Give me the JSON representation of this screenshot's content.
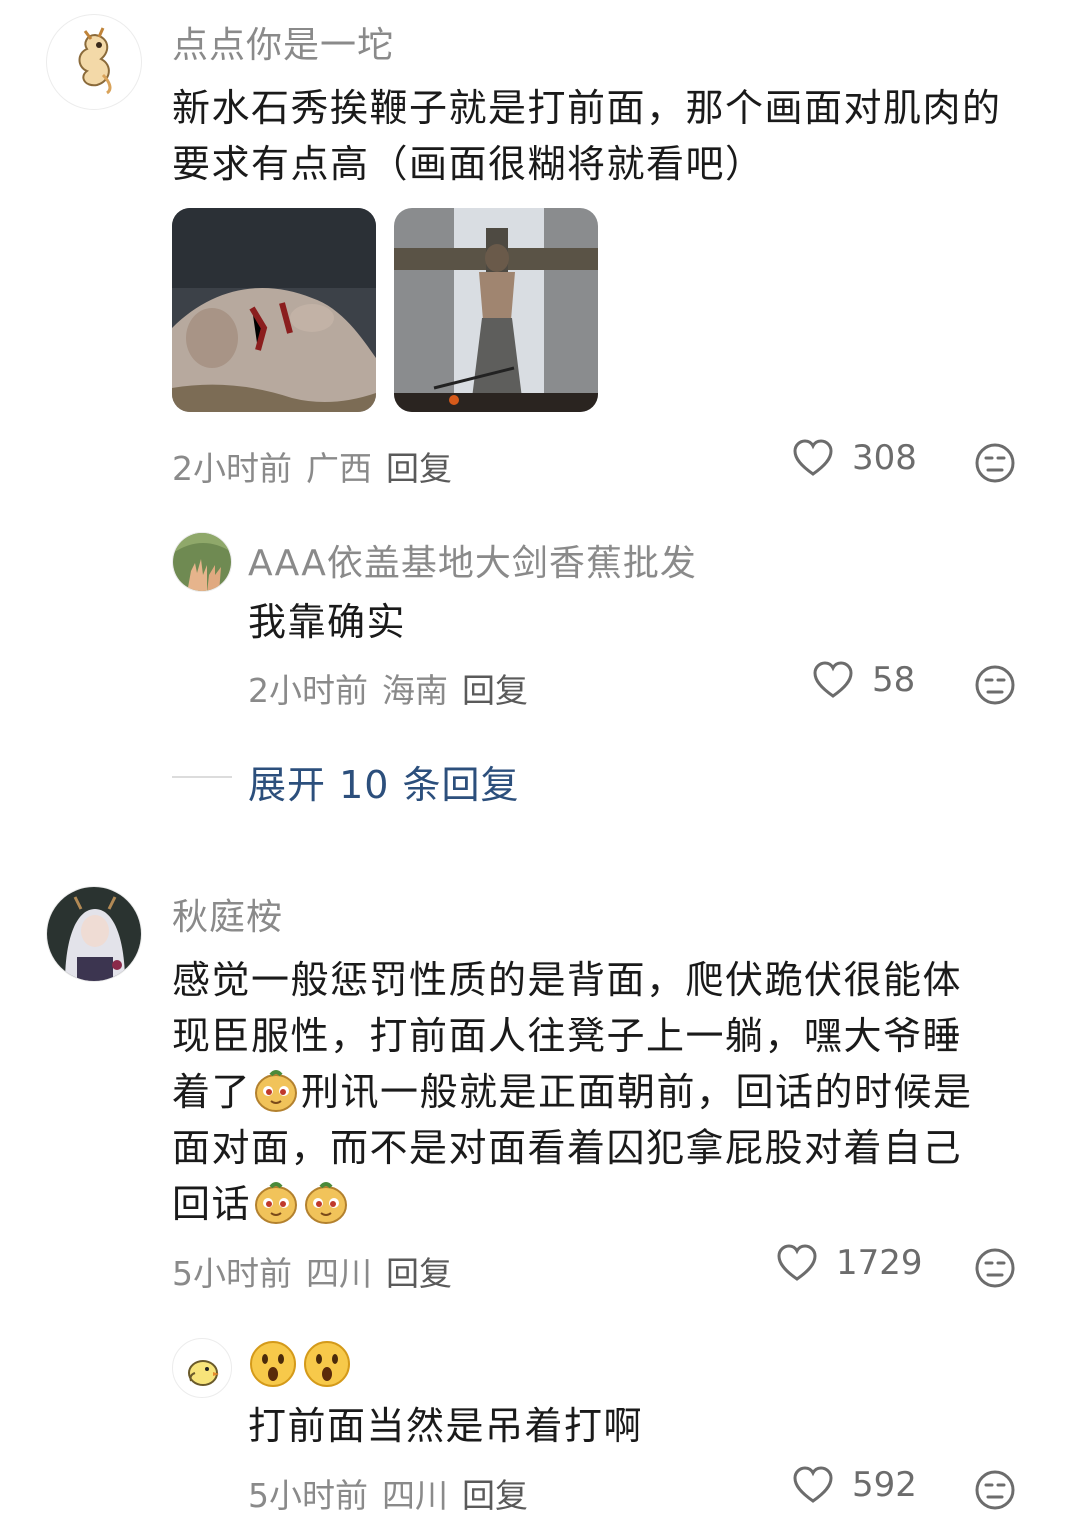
{
  "comments": [
    {
      "username": "点点你是一坨",
      "text": "新水石秀挨鞭子就是打前面，那个画面对肌肉的要求有点高（画面很糊将就看吧）",
      "time": "2小时前",
      "location": "广西",
      "reply_label": "回复",
      "likes": "308",
      "avatar_icon": "dragon-sticker-avatar",
      "images": [
        "bloody-man-lying-photo",
        "man-bound-on-cross-photo"
      ],
      "replies": [
        {
          "username": "AAA依盖基地大剑香蕉批发",
          "text": "我靠确实",
          "time": "2小时前",
          "location": "海南",
          "reply_label": "回复",
          "likes": "58",
          "avatar_icon": "hands-in-grass-avatar"
        }
      ],
      "expand_label": "展开 10 条回复"
    },
    {
      "username": "秋庭桉",
      "text_line1": "感觉一般惩罚性质的是背面，爬伏跪伏很能体",
      "text_line2": "现臣服性，打前面人往凳子上一躺，嘿大爷睡",
      "text_line3a": "着了",
      "text_line3b": "刑讯一般就是正面朝前，回话的时候是",
      "text_line4": "面对面，而不是对面看着囚犯拿屁股对着自己",
      "text_line5": "回话",
      "time": "5小时前",
      "location": "四川",
      "reply_label": "回复",
      "likes": "1729",
      "avatar_icon": "white-haired-character-avatar",
      "emoji_name": "sly-potato-emoji",
      "replies": [
        {
          "username_emoji": "surprised-face-emoji",
          "text": "打前面当然是吊着打啊",
          "time": "5小时前",
          "location": "四川",
          "reply_label": "回复",
          "likes": "592",
          "avatar_icon": "chick-sticker-avatar"
        }
      ]
    }
  ]
}
